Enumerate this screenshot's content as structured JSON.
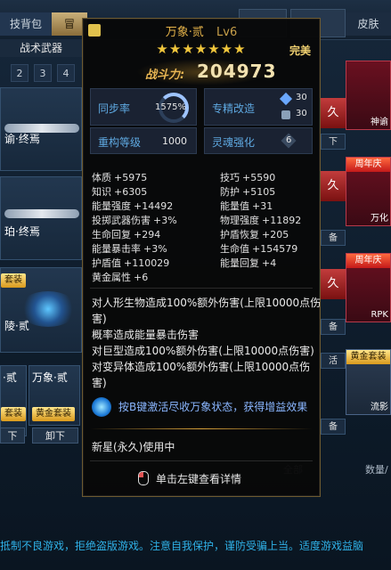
{
  "top_tabs": [
    "技背包",
    "冒",
    "皮肤"
  ],
  "sub_tab": "战术武器",
  "quick_nums": [
    "2",
    "3",
    "4"
  ],
  "left_cards": [
    {
      "name": "谕·终焉"
    },
    {
      "name": "珀·终焉"
    },
    {
      "name": "陵·贰",
      "tag": "套装"
    }
  ],
  "bottom_cards": [
    {
      "name": "·贰",
      "tag": "套装",
      "btn": "下"
    },
    {
      "name": "万象·贰",
      "tag": "黄金套装",
      "btn": "卸下"
    }
  ],
  "tooltip": {
    "title": "万象·贰",
    "level": "Lv6",
    "stars": "★★★★★★★",
    "quality": "完美",
    "power_label": "战斗力:",
    "power_value": "204973",
    "sync_label": "同步率",
    "sync_value": "1575%",
    "special_label": "专精改造",
    "special_vals": [
      "30",
      "30"
    ],
    "reforge_label": "重构等级",
    "reforge_value": "1000",
    "soul_label": "灵魂强化",
    "soul_value": "6",
    "stats_left": [
      {
        "k": "体质",
        "v": "+5975"
      },
      {
        "k": "知识",
        "v": "+6305"
      },
      {
        "k": "能量强度",
        "v": "+14492"
      },
      {
        "k": "投掷武器伤害",
        "v": "+3%"
      },
      {
        "k": "生命回复",
        "v": "+294"
      },
      {
        "k": "能量暴击率",
        "v": "+3%"
      },
      {
        "k": "护盾值",
        "v": "+110029"
      },
      {
        "k": "黄金属性",
        "v": "+6"
      }
    ],
    "stats_right": [
      {
        "k": "技巧",
        "v": "+5590"
      },
      {
        "k": "防护",
        "v": "+5105"
      },
      {
        "k": "能量值",
        "v": "+31"
      },
      {
        "k": "物理强度",
        "v": "+11892"
      },
      {
        "k": "护盾恢复",
        "v": "+205"
      },
      {
        "k": "生命值",
        "v": "+154579"
      },
      {
        "k": "能量回复",
        "v": "+4"
      }
    ],
    "desc_lines": [
      "对人形生物造成100%额外伤害(上限10000点伤",
      "害)",
      "概率造成能量暴击伤害",
      "对巨型造成100%额外伤害(上限10000点伤害)",
      "对变异体造成100%额外伤害(上限10000点伤",
      "害)"
    ],
    "activate_text": "按B键激活尽收万象状态，获得增益效果",
    "star_use": "新星(永久)使用中",
    "click_hint": "单击左键查看详情"
  },
  "right_panel": {
    "cards": [
      {
        "ribbon": "",
        "label": "神谕"
      },
      {
        "ribbon": "周年庆",
        "label": "万化"
      },
      {
        "ribbon": "周年庆",
        "label": "RPK"
      },
      {
        "ribbon": "黄金套装",
        "label": "流影"
      }
    ],
    "jiu": "久",
    "side_btns": [
      "下",
      "备",
      "备",
      "活",
      "备"
    ],
    "filter": "全部",
    "qty_label": "数量/"
  },
  "footer": "抵制不良游戏，拒绝盗版游戏。注意自我保护，谨防受骗上当。适度游戏益脑"
}
